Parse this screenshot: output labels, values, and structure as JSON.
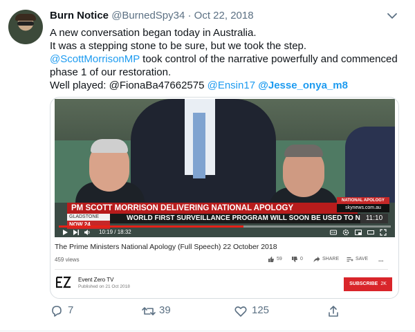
{
  "tweet": {
    "author_name": "Burn Notice",
    "author_handle": "@BurnedSpy34",
    "separator": "·",
    "date": "Oct 22, 2018",
    "text_line1": "A new conversation began today in Australia.",
    "text_line2": "It was a stepping stone to be sure, but we took the step.",
    "text_line3_mention": "@ScottMorrisonMP",
    "text_line3_rest": " took control of the narrative powerfully and commenced",
    "text_line4": "phase 1 of our restoration.",
    "text_line5_prefix": "Well played: @FionaBa47662575 ",
    "mention_ensin": "@Ensin17",
    "mention_jesse": "@Jesse_onya_m8"
  },
  "video": {
    "chyron_top": "PM SCOTT MORRISON DELIVERING NATIONAL APOLOGY",
    "channel_logo_text": "NATIONAL APOLOGY",
    "channel_site": "skynews.com.au",
    "location": "GLADSTONE",
    "now_label": "NOW 24",
    "chyron_bottom": "WORLD FIRST SURVEILLANCE PROGRAM WILL SOON BE USED TO N",
    "clock": "11:10",
    "time_elapsed": "10:19",
    "time_total": "18:32",
    "time_sep": " / ",
    "progress_fraction": 0.556,
    "title": "The Prime Ministers National Apology (Full Speech) 22 October 2018",
    "views": "459 views",
    "likes": "59",
    "dislikes": "0",
    "share_label": "SHARE",
    "save_label": "SAVE",
    "more_label": "...",
    "channel_name": "Event Zero TV",
    "published": "Published on 21 Oct 2018",
    "subscribe_label": "SUBSCRIBE",
    "subscriber_count": "2K"
  },
  "footer": {
    "replies": "7",
    "retweets": "39",
    "likes": "125"
  },
  "colors": {
    "link": "#1d9bf0",
    "muted": "#5b7083",
    "subscribe": "#d9252a",
    "chyron_red": "#b71c1c"
  }
}
